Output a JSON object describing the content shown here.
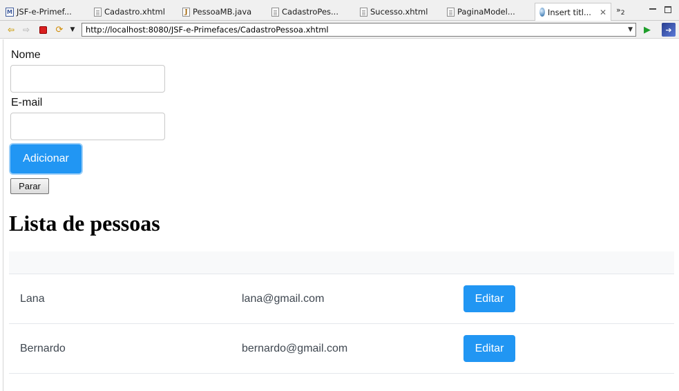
{
  "tabs": [
    {
      "label": "JSF-e-Primef...",
      "icon": "maven-pom-icon"
    },
    {
      "label": "Cadastro.xhtml",
      "icon": "xhtml-file-icon"
    },
    {
      "label": "PessoaMB.java",
      "icon": "java-file-icon"
    },
    {
      "label": "CadastroPes...",
      "icon": "xhtml-file-icon"
    },
    {
      "label": "Sucesso.xhtml",
      "icon": "xhtml-file-icon"
    },
    {
      "label": "PaginaModel...",
      "icon": "xhtml-file-icon"
    },
    {
      "label": "Insert titl...",
      "icon": "browser-globe-icon",
      "active": true
    }
  ],
  "tabs_overflow": "2",
  "browser": {
    "url": "http://localhost:8080/JSF-e-Primefaces/CadastroPessoa.xhtml"
  },
  "form": {
    "name_label": "Nome",
    "name_value": "",
    "email_label": "E-mail",
    "email_value": "",
    "add_button": "Adicionar",
    "stop_button": "Parar"
  },
  "list": {
    "title": "Lista de pessoas",
    "rows": [
      {
        "name": "Lana",
        "email": "lana@gmail.com",
        "action": "Editar"
      },
      {
        "name": "Bernardo",
        "email": "bernardo@gmail.com",
        "action": "Editar"
      }
    ]
  },
  "colors": {
    "primary": "#2196f3",
    "header_bg": "#f8f9fa"
  }
}
